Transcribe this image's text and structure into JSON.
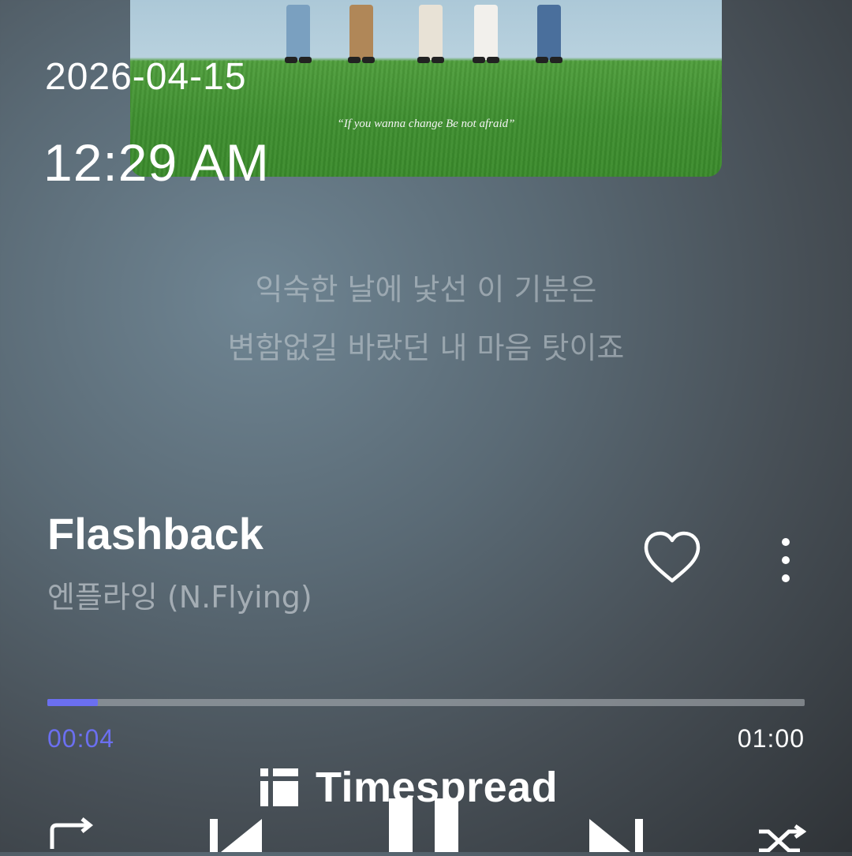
{
  "status": {
    "date": "2026-04-15",
    "time": "12:29 AM"
  },
  "album_art": {
    "quote": "“If you wanna change Be not afraid”"
  },
  "lyrics": [
    "익숙한 날에 낯선 이 기분은",
    "변함없길 바랐던 내 마음 탓이죠"
  ],
  "track": {
    "title": "Flashback",
    "artist": "엔플라잉 (N.Flying)"
  },
  "icons": {
    "like": "heart-icon",
    "more": "more-vertical-icon",
    "repeat": "repeat-icon",
    "previous": "skip-previous-icon",
    "play_pause": "pause-icon",
    "next": "skip-next-icon",
    "shuffle": "shuffle-icon",
    "watermark_logo": "timespread-logo-icon"
  },
  "playback": {
    "elapsed": "00:04",
    "total": "01:00",
    "progress": 0.0667
  },
  "watermark": "Timespread",
  "colors": {
    "accent": "#6b6ff0",
    "lyrics_dim": "#c8d0d6"
  }
}
